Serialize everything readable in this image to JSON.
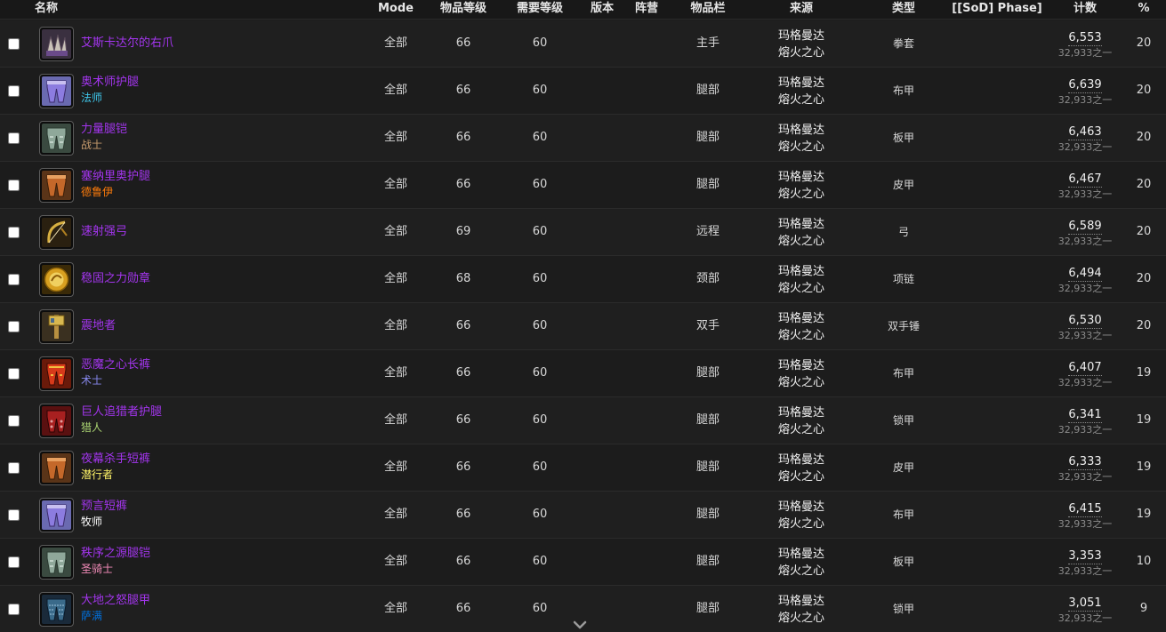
{
  "columns": {
    "name": "名称",
    "mode": "Mode",
    "item_level": "物品等级",
    "req_level": "需要等级",
    "version": "版本",
    "faction": "阵营",
    "slot": "物品栏",
    "source": "来源",
    "type": "类型",
    "sod_phase": "[[SoD] Phase]",
    "count": "计数",
    "pct": "%"
  },
  "colors": {
    "epic": "#a335ee",
    "mage": "#3fc7eb",
    "warrior": "#c69b6d",
    "druid": "#ff7c0a",
    "warlock": "#8788ee",
    "hunter": "#aad372",
    "rogue": "#fff468",
    "priest": "#ffffff",
    "paladin": "#f48cba",
    "shaman": "#0070dd"
  },
  "rows": [
    {
      "name": "艾斯卡达尔的右爪",
      "class": "",
      "class_color": "",
      "icon": "fist-weapon-icon",
      "mode": "全部",
      "item_level": "66",
      "req_level": "60",
      "slot": "主手",
      "source_npc": "玛格曼达",
      "source_zone": "熔火之心",
      "type": "拳套",
      "count": "6,553",
      "count_of": "32,933之一",
      "pct": "20"
    },
    {
      "name": "奥术师护腿",
      "class": "法师",
      "class_color": "#3fc7eb",
      "icon": "purple-legs-icon",
      "mode": "全部",
      "item_level": "66",
      "req_level": "60",
      "slot": "腿部",
      "source_npc": "玛格曼达",
      "source_zone": "熔火之心",
      "type": "布甲",
      "count": "6,639",
      "count_of": "32,933之一",
      "pct": "20"
    },
    {
      "name": "力量腿铠",
      "class": "战士",
      "class_color": "#c69b6d",
      "icon": "green-plate-legs-icon",
      "mode": "全部",
      "item_level": "66",
      "req_level": "60",
      "slot": "腿部",
      "source_npc": "玛格曼达",
      "source_zone": "熔火之心",
      "type": "板甲",
      "count": "6,463",
      "count_of": "32,933之一",
      "pct": "20"
    },
    {
      "name": "塞纳里奥护腿",
      "class": "德鲁伊",
      "class_color": "#ff7c0a",
      "icon": "leather-legs-icon",
      "mode": "全部",
      "item_level": "66",
      "req_level": "60",
      "slot": "腿部",
      "source_npc": "玛格曼达",
      "source_zone": "熔火之心",
      "type": "皮甲",
      "count": "6,467",
      "count_of": "32,933之一",
      "pct": "20"
    },
    {
      "name": "速射强弓",
      "class": "",
      "class_color": "",
      "icon": "bow-icon",
      "mode": "全部",
      "item_level": "69",
      "req_level": "60",
      "slot": "远程",
      "source_npc": "玛格曼达",
      "source_zone": "熔火之心",
      "type": "弓",
      "count": "6,589",
      "count_of": "32,933之一",
      "pct": "20"
    },
    {
      "name": "稳固之力勋章",
      "class": "",
      "class_color": "",
      "icon": "gold-medallion-icon",
      "mode": "全部",
      "item_level": "68",
      "req_level": "60",
      "slot": "颈部",
      "source_npc": "玛格曼达",
      "source_zone": "熔火之心",
      "type": "项链",
      "count": "6,494",
      "count_of": "32,933之一",
      "pct": "20"
    },
    {
      "name": "震地者",
      "class": "",
      "class_color": "",
      "icon": "two-hand-mace-icon",
      "mode": "全部",
      "item_level": "66",
      "req_level": "60",
      "slot": "双手",
      "source_npc": "玛格曼达",
      "source_zone": "熔火之心",
      "type": "双手锤",
      "count": "6,530",
      "count_of": "32,933之一",
      "pct": "20"
    },
    {
      "name": "恶魔之心长裤",
      "class": "术士",
      "class_color": "#8788ee",
      "icon": "red-gold-legs-icon",
      "mode": "全部",
      "item_level": "66",
      "req_level": "60",
      "slot": "腿部",
      "source_npc": "玛格曼达",
      "source_zone": "熔火之心",
      "type": "布甲",
      "count": "6,407",
      "count_of": "32,933之一",
      "pct": "19"
    },
    {
      "name": "巨人追猎者护腿",
      "class": "猎人",
      "class_color": "#aad372",
      "icon": "red-mail-legs-icon",
      "mode": "全部",
      "item_level": "66",
      "req_level": "60",
      "slot": "腿部",
      "source_npc": "玛格曼达",
      "source_zone": "熔火之心",
      "type": "锁甲",
      "count": "6,341",
      "count_of": "32,933之一",
      "pct": "19"
    },
    {
      "name": "夜幕杀手短裤",
      "class": "潜行者",
      "class_color": "#fff468",
      "icon": "leather-legs-icon",
      "mode": "全部",
      "item_level": "66",
      "req_level": "60",
      "slot": "腿部",
      "source_npc": "玛格曼达",
      "source_zone": "熔火之心",
      "type": "皮甲",
      "count": "6,333",
      "count_of": "32,933之一",
      "pct": "19"
    },
    {
      "name": "预言短裤",
      "class": "牧师",
      "class_color": "#ffffff",
      "icon": "purple-legs-icon",
      "mode": "全部",
      "item_level": "66",
      "req_level": "60",
      "slot": "腿部",
      "source_npc": "玛格曼达",
      "source_zone": "熔火之心",
      "type": "布甲",
      "count": "6,415",
      "count_of": "32,933之一",
      "pct": "19"
    },
    {
      "name": "秩序之源腿铠",
      "class": "圣骑士",
      "class_color": "#f48cba",
      "icon": "green-plate-legs-icon",
      "mode": "全部",
      "item_level": "66",
      "req_level": "60",
      "slot": "腿部",
      "source_npc": "玛格曼达",
      "source_zone": "熔火之心",
      "type": "板甲",
      "count": "3,353",
      "count_of": "32,933之一",
      "pct": "10"
    },
    {
      "name": "大地之怒腿甲",
      "class": "萨满",
      "class_color": "#0070dd",
      "icon": "blue-mail-legs-icon",
      "mode": "全部",
      "item_level": "66",
      "req_level": "60",
      "slot": "腿部",
      "source_npc": "玛格曼达",
      "source_zone": "熔火之心",
      "type": "锁甲",
      "count": "3,051",
      "count_of": "32,933之一",
      "pct": "9"
    }
  ]
}
